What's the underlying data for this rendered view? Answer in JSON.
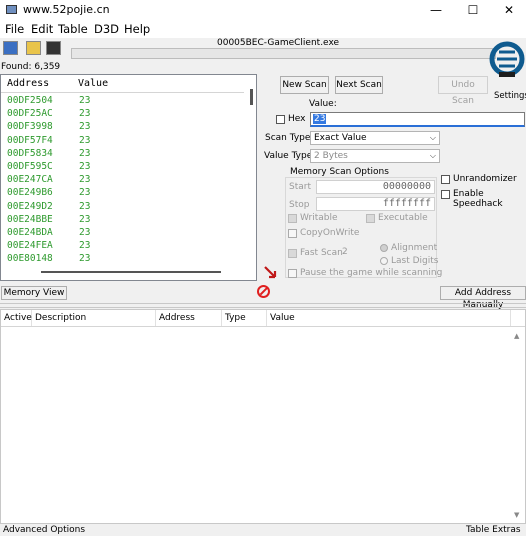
{
  "window": {
    "title": "www.52pojie.cn",
    "minimize_glyph": "—",
    "maximize_glyph": "☐",
    "close_glyph": "✕"
  },
  "menu": [
    "File",
    "Edit",
    "Table",
    "D3D",
    "Help"
  ],
  "toolbar": {
    "icons": [
      "open-process-icon",
      "open-file-icon",
      "save-icon"
    ]
  },
  "process_title": "00005BEC-GameClient.exe",
  "found_label": "Found: 6,359",
  "results": {
    "headers": {
      "address": "Address",
      "value": "Value"
    },
    "rows": [
      {
        "address": "00DF2504",
        "value": "23"
      },
      {
        "address": "00DF25AC",
        "value": "23"
      },
      {
        "address": "00DF3998",
        "value": "23"
      },
      {
        "address": "00DF57F4",
        "value": "23"
      },
      {
        "address": "00DF5834",
        "value": "23"
      },
      {
        "address": "00DF595C",
        "value": "23"
      },
      {
        "address": "00E247CA",
        "value": "23"
      },
      {
        "address": "00E249B6",
        "value": "23"
      },
      {
        "address": "00E249D2",
        "value": "23"
      },
      {
        "address": "00E24BBE",
        "value": "23"
      },
      {
        "address": "00E24BDA",
        "value": "23"
      },
      {
        "address": "00E24FEA",
        "value": "23"
      },
      {
        "address": "00E80148",
        "value": "23"
      }
    ],
    "value_color": "#2e9a2e"
  },
  "scan": {
    "new_scan": "New Scan",
    "next_scan": "Next Scan",
    "undo_scan": "Undo Scan",
    "settings_label": "Settings",
    "value_label": "Value:",
    "hex_label": "Hex",
    "value": "23",
    "scan_type_label": "Scan Type",
    "scan_type": "Exact Value",
    "value_type_label": "Value Type",
    "value_type": "2 Bytes",
    "memory_options_title": "Memory Scan Options",
    "start_label": "Start",
    "start_value": "00000000",
    "stop_label": "Stop",
    "stop_value": "ffffffff",
    "writable": "Writable",
    "executable": "Executable",
    "copy_on_write": "CopyOnWrite",
    "fast_scan": "Fast Scan",
    "fast_scan_value": "2",
    "alignment": "Alignment",
    "last_digits": "Last Digits",
    "pause_game": "Pause the game while scanning",
    "unrandomizer": "Unrandomizer",
    "enable_speedhack": "Enable Speedhack",
    "accent_color": "#2a6fd6"
  },
  "buttons": {
    "memory_view": "Memory View",
    "add_address": "Add Address Manually"
  },
  "address_table": {
    "headers": [
      "Active",
      "Description",
      "Address",
      "Type",
      "Value"
    ]
  },
  "status": {
    "advanced_options": "Advanced Options",
    "table_extras": "Table Extras"
  }
}
